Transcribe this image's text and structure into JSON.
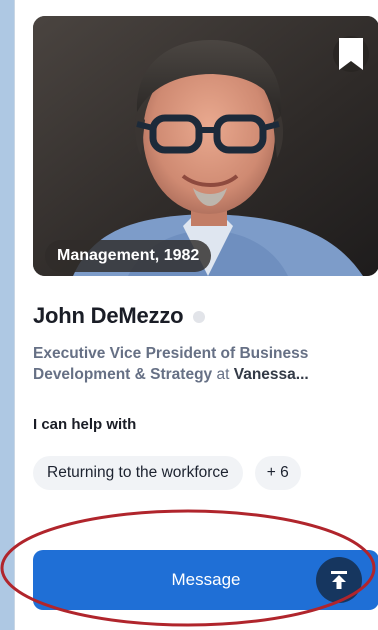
{
  "profile": {
    "photo_tag": "Management, 1982",
    "name": "John DeMezzo",
    "headline": {
      "title_line1": "Executive Vice President of Business",
      "title_line2": "Development & Strategy",
      "connector": " at ",
      "company": "Vanessa..."
    }
  },
  "help": {
    "heading": "I can help with",
    "chips": [
      "Returning to the workforce"
    ],
    "more": "+ 6"
  },
  "actions": {
    "message_label": "Message"
  },
  "icons": {
    "bookmark": "bookmark-icon",
    "scroll_top": "arrow-to-top-icon"
  },
  "colors": {
    "page_background": "#aec8e3",
    "primary_button": "#1f6fd6",
    "scroll_top_button": "#16365f",
    "annotation_ellipse": "#b0252c"
  }
}
